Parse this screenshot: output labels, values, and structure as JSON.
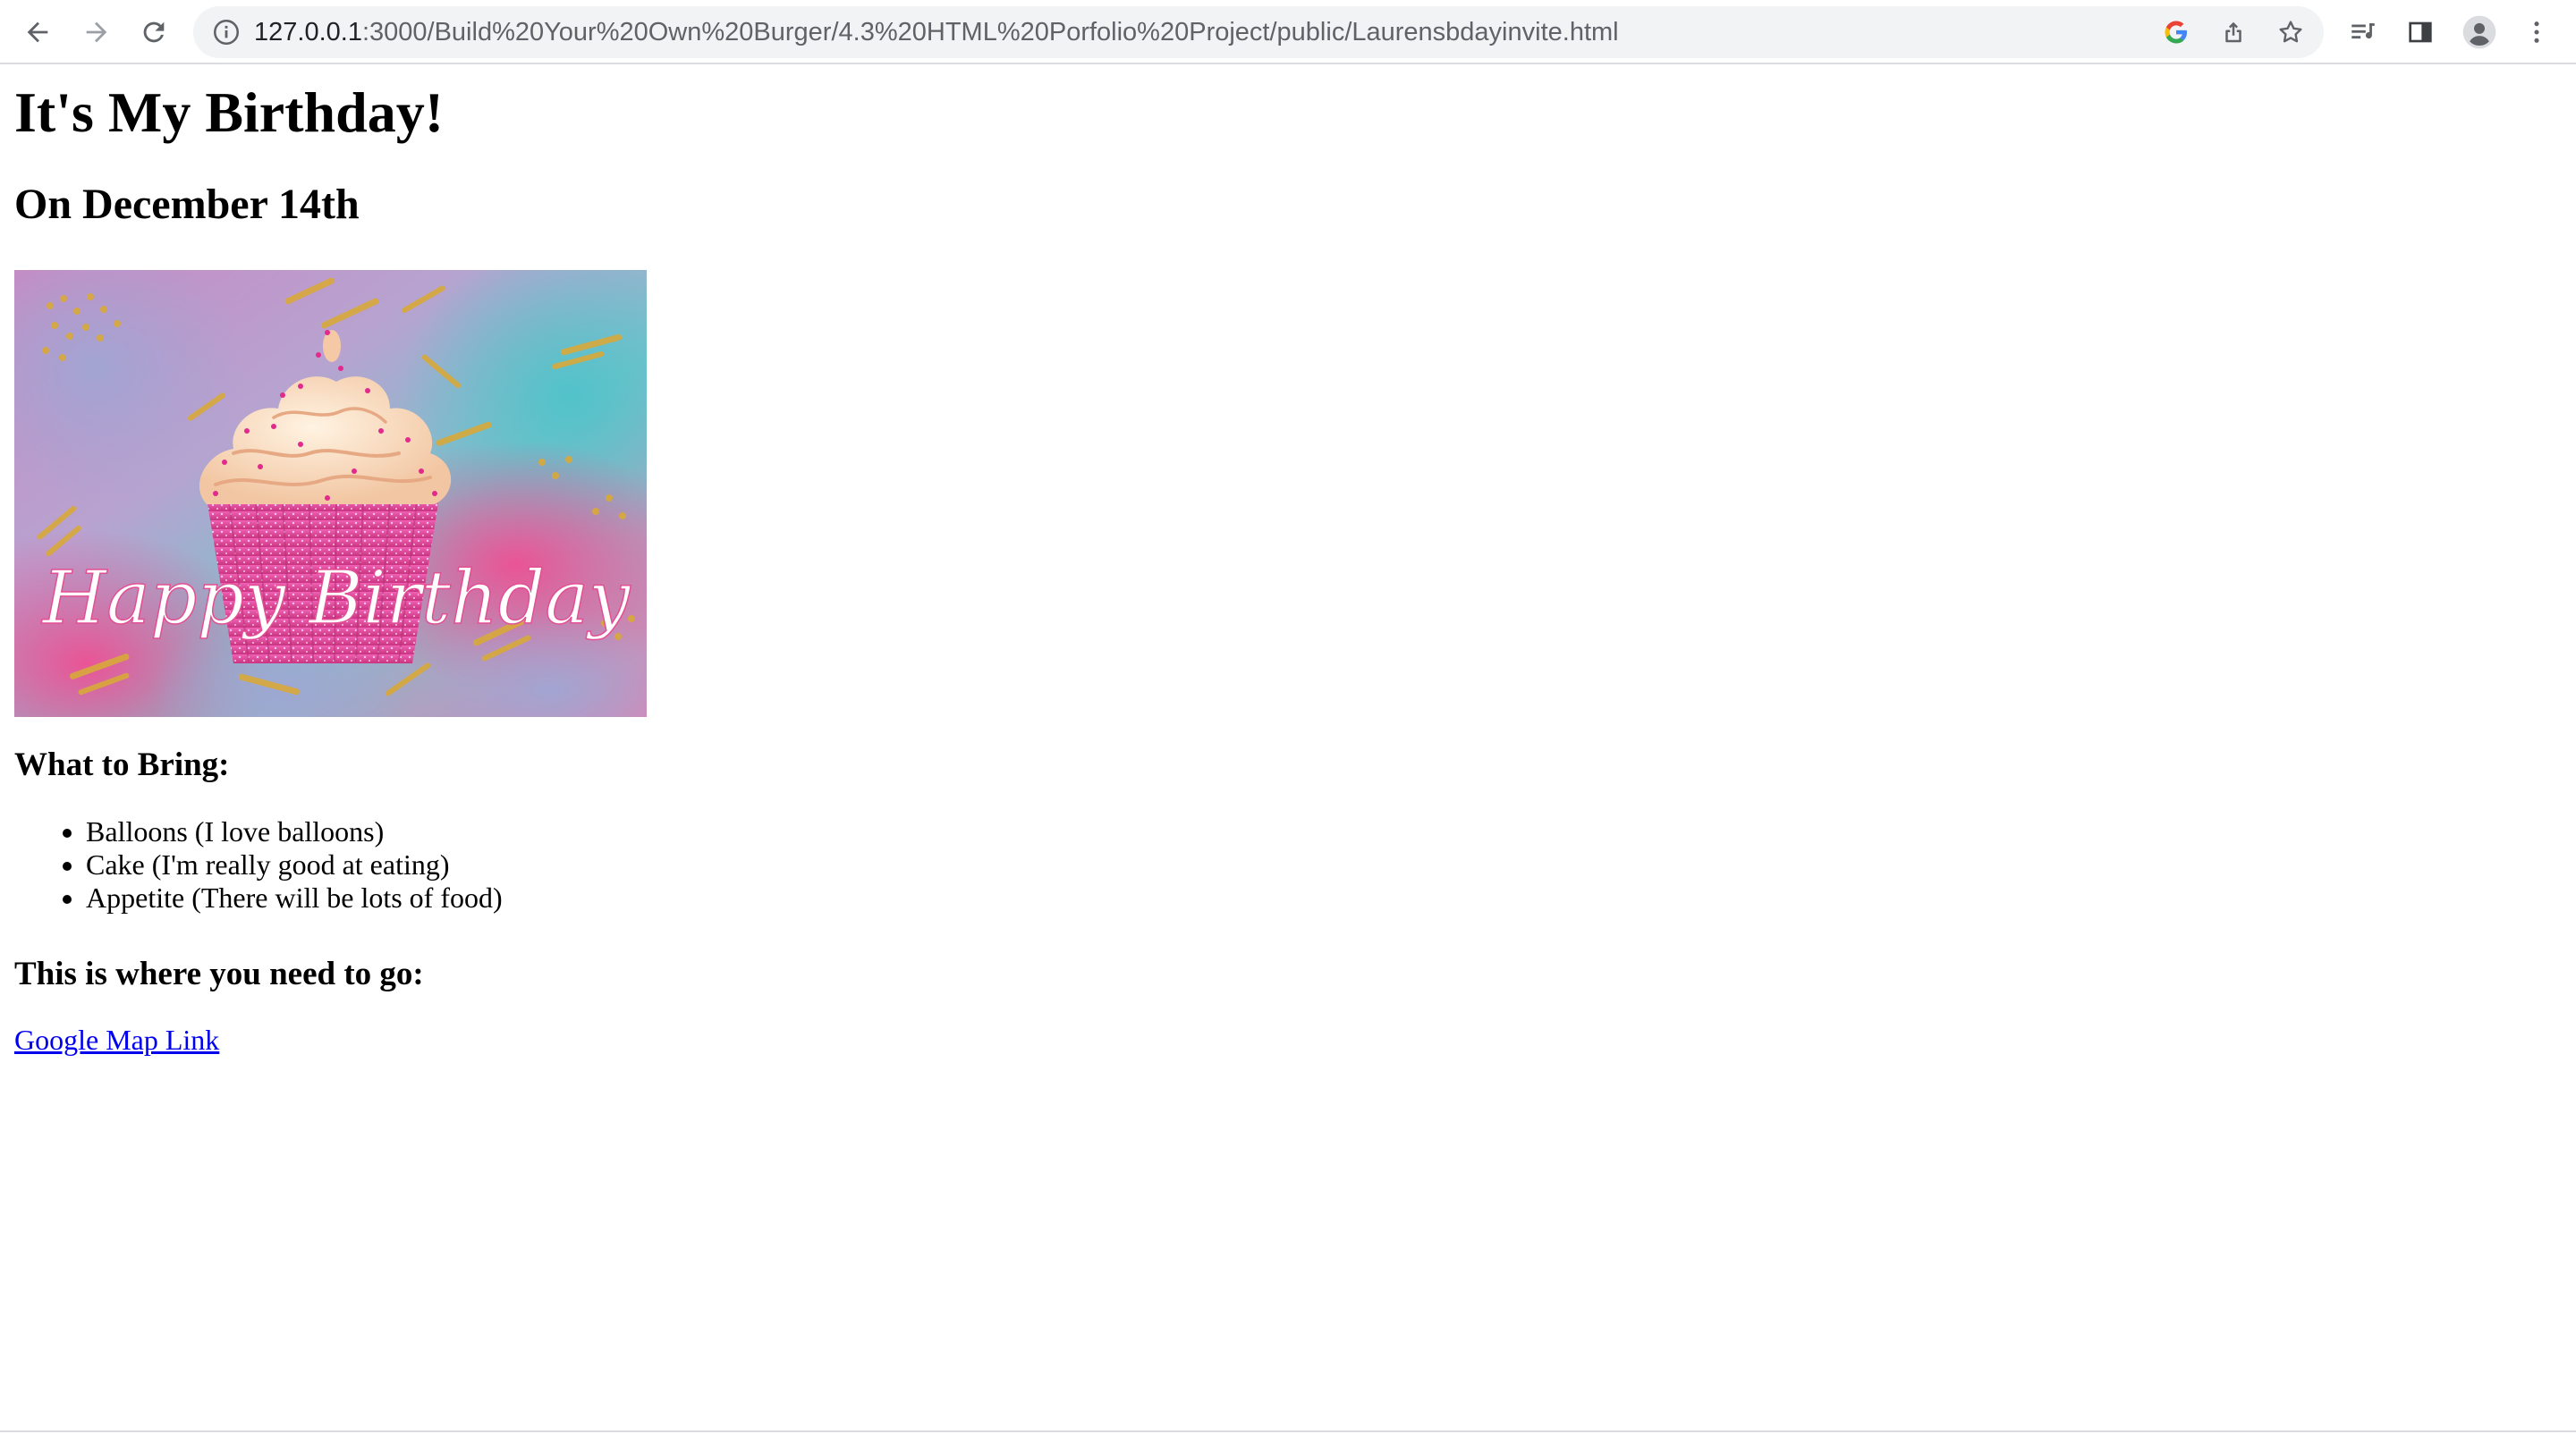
{
  "browser": {
    "url_host": "127.0.0.1",
    "url_rest": ":3000/Build%20Your%20Own%20Burger/4.3%20HTML%20Porfolio%20Project/public/Laurensbdayinvite.html",
    "icons": {
      "back": "arrow-left",
      "forward": "arrow-right",
      "reload": "refresh",
      "site_info": "info-circle",
      "google": "google-g",
      "share": "share",
      "bookmark": "star-outline",
      "reading_list": "reading-list",
      "side_panel": "side-panel",
      "profile": "person-avatar",
      "menu": "three-dots-vertical"
    }
  },
  "page": {
    "heading": "It's My Birthday!",
    "date_heading": "On December 14th",
    "image": {
      "script_text": "Happy Birthday",
      "colors": {
        "pink": "#e8508f",
        "teal": "#5fbfc8",
        "lavender": "#c9a8d3",
        "gold": "#d8a93a",
        "frosting": "#f7d8b8"
      }
    },
    "bring_heading": "What to Bring:",
    "bring_items": [
      "Balloons (I love balloons)",
      "Cake (I'm really good at eating)",
      "Appetite (There will be lots of food)"
    ],
    "location_heading": "This is where you need to go:",
    "map_link_text": "Google Map Link",
    "link_color": "#0000ee"
  }
}
